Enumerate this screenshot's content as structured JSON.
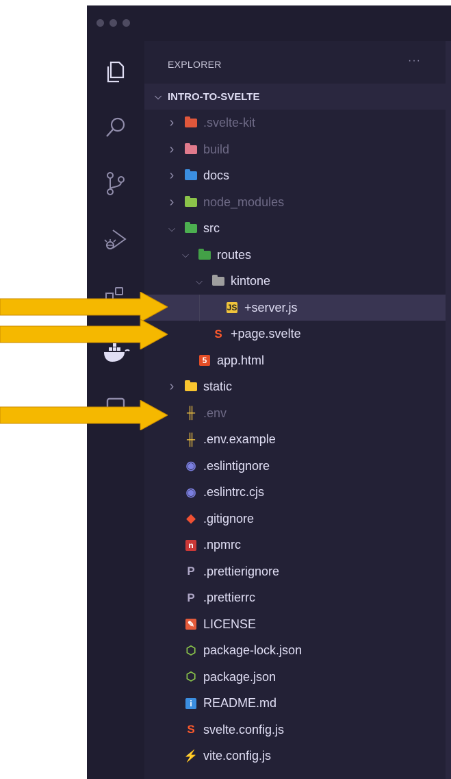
{
  "explorer": {
    "title": "EXPLORER",
    "more": "···"
  },
  "activity_bar": [
    "files-icon",
    "search-icon",
    "source-control-icon",
    "run-debug-icon",
    "extensions-icon",
    "docker-icon",
    "remote-icon"
  ],
  "tree": [
    {
      "label": "INTRO-TO-SVELTE",
      "depth": 0,
      "type": "root",
      "expanded": true
    },
    {
      "label": ".svelte-kit",
      "depth": 1,
      "type": "folder",
      "expanded": false,
      "color": "#e0573b",
      "dim": true
    },
    {
      "label": "build",
      "depth": 1,
      "type": "folder",
      "expanded": false,
      "color": "#e07a8c",
      "dim": true
    },
    {
      "label": "docs",
      "depth": 1,
      "type": "folder",
      "expanded": false,
      "color": "#3b8ee0"
    },
    {
      "label": "node_modules",
      "depth": 1,
      "type": "folder",
      "expanded": false,
      "color": "#8bc34a",
      "dim": true
    },
    {
      "label": "src",
      "depth": 1,
      "type": "folder",
      "expanded": true,
      "color": "#4caf50"
    },
    {
      "label": "routes",
      "depth": 2,
      "type": "folder",
      "expanded": true,
      "color": "#43a047"
    },
    {
      "label": "kintone",
      "depth": 3,
      "type": "folder",
      "expanded": true,
      "color": "#9e9e9e"
    },
    {
      "label": "+server.js",
      "depth": 4,
      "type": "file",
      "icon": "js",
      "selected": true
    },
    {
      "label": "+page.svelte",
      "depth": 3,
      "type": "file",
      "icon": "svelte"
    },
    {
      "label": "app.html",
      "depth": 2,
      "type": "file",
      "icon": "html"
    },
    {
      "label": "static",
      "depth": 1,
      "type": "folder",
      "expanded": false,
      "color": "#f9c52f"
    },
    {
      "label": ".env",
      "depth": 1,
      "type": "file",
      "icon": "env",
      "dim": true
    },
    {
      "label": ".env.example",
      "depth": 1,
      "type": "file",
      "icon": "env"
    },
    {
      "label": ".eslintignore",
      "depth": 1,
      "type": "file",
      "icon": "eslint"
    },
    {
      "label": ".eslintrc.cjs",
      "depth": 1,
      "type": "file",
      "icon": "eslint"
    },
    {
      "label": ".gitignore",
      "depth": 1,
      "type": "file",
      "icon": "git"
    },
    {
      "label": ".npmrc",
      "depth": 1,
      "type": "file",
      "icon": "npm"
    },
    {
      "label": ".prettierignore",
      "depth": 1,
      "type": "file",
      "icon": "prettier"
    },
    {
      "label": ".prettierrc",
      "depth": 1,
      "type": "file",
      "icon": "prettier"
    },
    {
      "label": "LICENSE",
      "depth": 1,
      "type": "file",
      "icon": "license"
    },
    {
      "label": "package-lock.json",
      "depth": 1,
      "type": "file",
      "icon": "node"
    },
    {
      "label": "package.json",
      "depth": 1,
      "type": "file",
      "icon": "node"
    },
    {
      "label": "README.md",
      "depth": 1,
      "type": "file",
      "icon": "info"
    },
    {
      "label": "svelte.config.js",
      "depth": 1,
      "type": "file",
      "icon": "svelte"
    },
    {
      "label": "vite.config.js",
      "depth": 1,
      "type": "file",
      "icon": "vite"
    }
  ],
  "colors": {
    "background": "#232136",
    "activity_bar": "#1f1d30",
    "arrow": "#f5b800"
  }
}
